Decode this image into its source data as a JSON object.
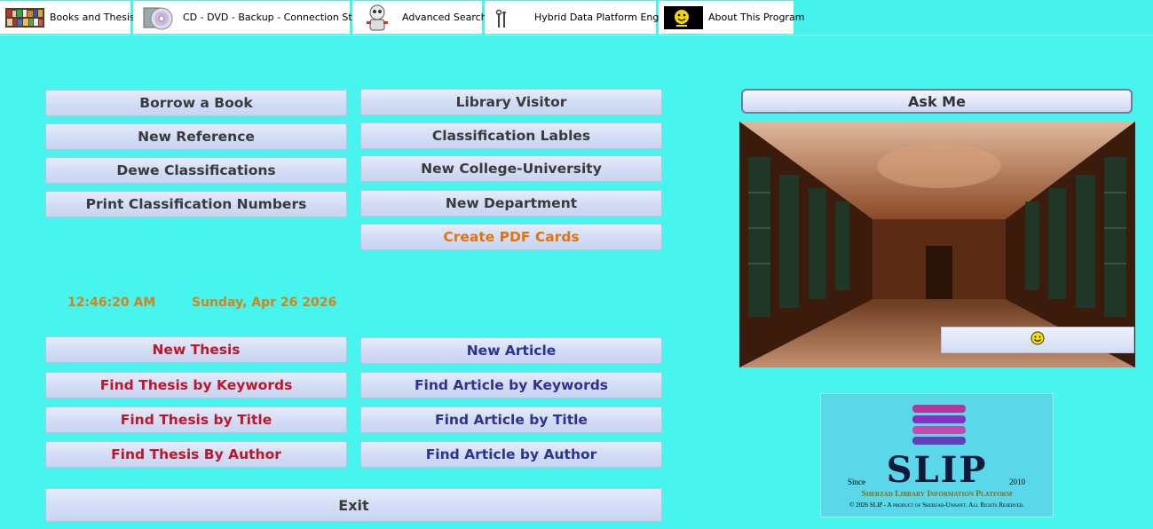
{
  "tabs": [
    {
      "label": "Books and Thesis",
      "icon": "bookshelf-icon"
    },
    {
      "label": "CD - DVD - Backup - Connection Status",
      "icon": "cd-disc-icon"
    },
    {
      "label": "Advanced Search",
      "icon": "robot-search-icon"
    },
    {
      "label": "Hybrid Data Platform Engine",
      "icon": "tools-icon"
    },
    {
      "label": "About This Program",
      "icon": "smiley-about-icon"
    }
  ],
  "left_buttons": [
    "Borrow a Book",
    "New Reference",
    "Dewe Classifications",
    "Print Classification Numbers"
  ],
  "middle_buttons": [
    "Library Visitor",
    "Classification Lables",
    "New College-University",
    "New Department",
    "Create PDF Cards"
  ],
  "clock": {
    "time": "12:46:20 AM",
    "date": "Sunday, Apr 26 2026"
  },
  "thesis_buttons": [
    "New Thesis",
    "Find Thesis by Keywords",
    "Find Thesis by Title",
    "Find Thesis By Author"
  ],
  "article_buttons": [
    "New Article",
    "Find Article by Keywords",
    "Find Article by Title",
    "Find Article by Author"
  ],
  "exit_label": "Exit",
  "ask_me_label": "Ask Me",
  "logo": {
    "since": "Since",
    "year": "2010",
    "name": "SLIP",
    "tagline": "Sherzad Library Information Platform",
    "copyright": "© 2026 SLIP - A product of Sherzad-Unisoft. All Rights Reserved."
  },
  "colors": {
    "background": "#47F4EE",
    "thesis": "#c0162a",
    "article": "#2b3393",
    "pdf": "#e0740c",
    "clock": "#d78216"
  }
}
